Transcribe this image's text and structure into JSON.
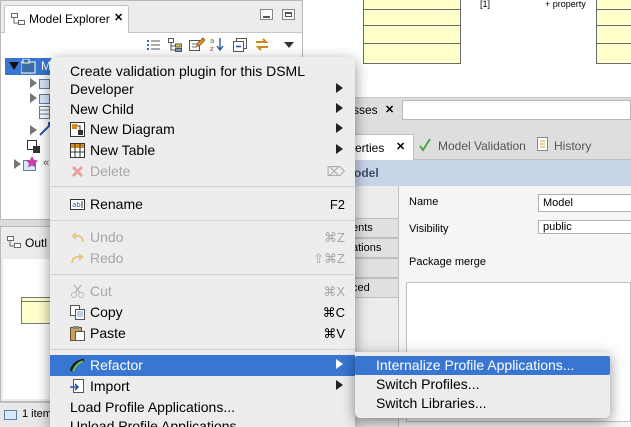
{
  "model_explorer": {
    "title": "Model Explorer",
    "close_symbol": "✕",
    "tree_root_label": "M",
    "tree_profile_label": "«"
  },
  "outline": {
    "title": "Outl"
  },
  "status_bar": {
    "text": "1 item"
  },
  "diagram": {
    "multiplicity": "[1]",
    "property_label": "+ property"
  },
  "editor": {
    "classes_tab_label": "sses",
    "properties_tab_label": "erties",
    "model_validation_tab_label": "Model Validation",
    "history_tab_label": "History",
    "header_title": "odel"
  },
  "properties": {
    "side_tabs": [
      "ents",
      "ations",
      "",
      "ced"
    ],
    "name_label": "Name",
    "name_value": "Model",
    "visibility_label": "Visibility",
    "visibility_value": "public",
    "package_merge_label": "Package merge"
  },
  "context_menu": {
    "items": [
      {
        "label": "Create validation plugin for this DSML",
        "icon": ""
      },
      {
        "label": "Developer",
        "icon": "",
        "submenu": true
      },
      {
        "label": "New Child",
        "icon": "",
        "submenu": true
      },
      {
        "label": "New Diagram",
        "icon": "new-diagram-icon",
        "submenu": true
      },
      {
        "label": "New Table",
        "icon": "new-table-icon",
        "submenu": true
      },
      {
        "label": "Delete",
        "icon": "delete-icon",
        "disabled": true,
        "shortcut": "⌦"
      },
      {
        "label": "Rename",
        "icon": "rename-icon",
        "shortcut": "F2"
      },
      {
        "label": "Undo",
        "icon": "undo-icon",
        "disabled": true,
        "shortcut": "⌘Z"
      },
      {
        "label": "Redo",
        "icon": "redo-icon",
        "disabled": true,
        "shortcut": "⇧⌘Z"
      },
      {
        "label": "Cut",
        "icon": "cut-icon",
        "disabled": true,
        "shortcut": "⌘X"
      },
      {
        "label": "Copy",
        "icon": "copy-icon",
        "shortcut": "⌘C"
      },
      {
        "label": "Paste",
        "icon": "paste-icon",
        "shortcut": "⌘V"
      },
      {
        "label": "Refactor",
        "icon": "refactor-icon",
        "submenu": true,
        "selected": true
      },
      {
        "label": "Import",
        "icon": "import-icon",
        "submenu": true
      },
      {
        "label": "Load Profile Applications...",
        "icon": ""
      },
      {
        "label": "Unload Profile Applications...",
        "icon": ""
      }
    ]
  },
  "refactor_submenu": {
    "items": [
      {
        "label": "Internalize Profile Applications...",
        "selected": true
      },
      {
        "label": "Switch Profiles..."
      },
      {
        "label": "Switch Libraries..."
      }
    ]
  },
  "colors": {
    "menu_background": "#ededed",
    "selection": "#3876d2",
    "uml_class_fill": "#ffffcc",
    "properties_header": "#c7d3e6"
  }
}
